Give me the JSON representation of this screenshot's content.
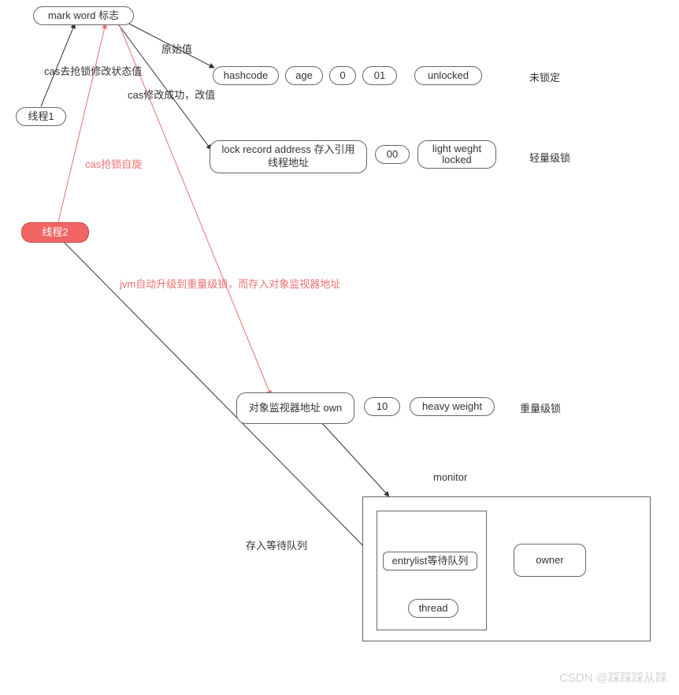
{
  "nodes": {
    "markword": "mark word 标志",
    "thread1": "线程1",
    "thread2": "线程2",
    "hashcode": "hashcode",
    "age": "age",
    "bit0": "0",
    "bit01": "01",
    "unlocked": "unlocked",
    "lockrec": "lock record address 存入引用线程地址",
    "bit00": "00",
    "lightw": "light weght locked",
    "monaddr": "对象监视器地址 own",
    "bit10": "10",
    "heavy": "heavy weight",
    "entrylist": "entrylist等待队列",
    "thread_in": "thread",
    "owner": "owner"
  },
  "edge_labels": {
    "orig": "原始值",
    "cas_try": "cas去抢锁修改状态值",
    "cas_ok": "cas修改成功，改值",
    "cas_spin": "cas抢锁自旋",
    "jvm_upgrade": "jvm自动升级到重量级锁，而存入对象监视器地址",
    "enqueue": "存入等待队列"
  },
  "side_labels": {
    "unlocked": "未锁定",
    "light": "轻量级锁",
    "heavy": "重量级锁",
    "monitor": "monitor"
  },
  "watermark": "CSDN @踩踩踩从踩"
}
